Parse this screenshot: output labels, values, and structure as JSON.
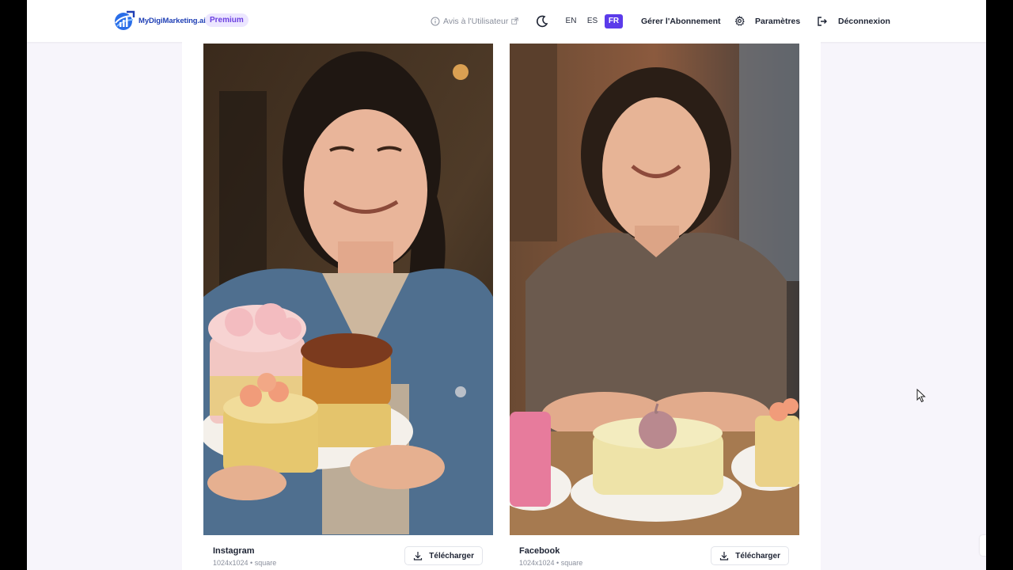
{
  "header": {
    "logo_text": "MyDigiMarketing.ai",
    "plan_badge": "Premium",
    "feedback_label": "Avis à l'Utilisateur",
    "languages": [
      "EN",
      "ES",
      "FR"
    ],
    "active_language": "FR",
    "subscription_label": "Gérer l'Abonnement",
    "settings_label": "Paramètres",
    "logout_label": "Déconnexion"
  },
  "cards": [
    {
      "platform": "Instagram",
      "meta": "1024x1024 • square",
      "download_label": "Télécharger"
    },
    {
      "platform": "Facebook",
      "meta": "1024x1024 • square",
      "download_label": "Télécharger"
    }
  ],
  "colors": {
    "accent": "#5b3bea",
    "brand_blue": "#1f3fb5",
    "premium_bg": "#ece6ff",
    "page_bg": "#f7f5fb"
  },
  "icons": [
    "logo-icon",
    "info-icon",
    "external-link-icon",
    "moon-icon",
    "gear-icon",
    "logout-icon",
    "download-icon",
    "cursor-icon"
  ]
}
